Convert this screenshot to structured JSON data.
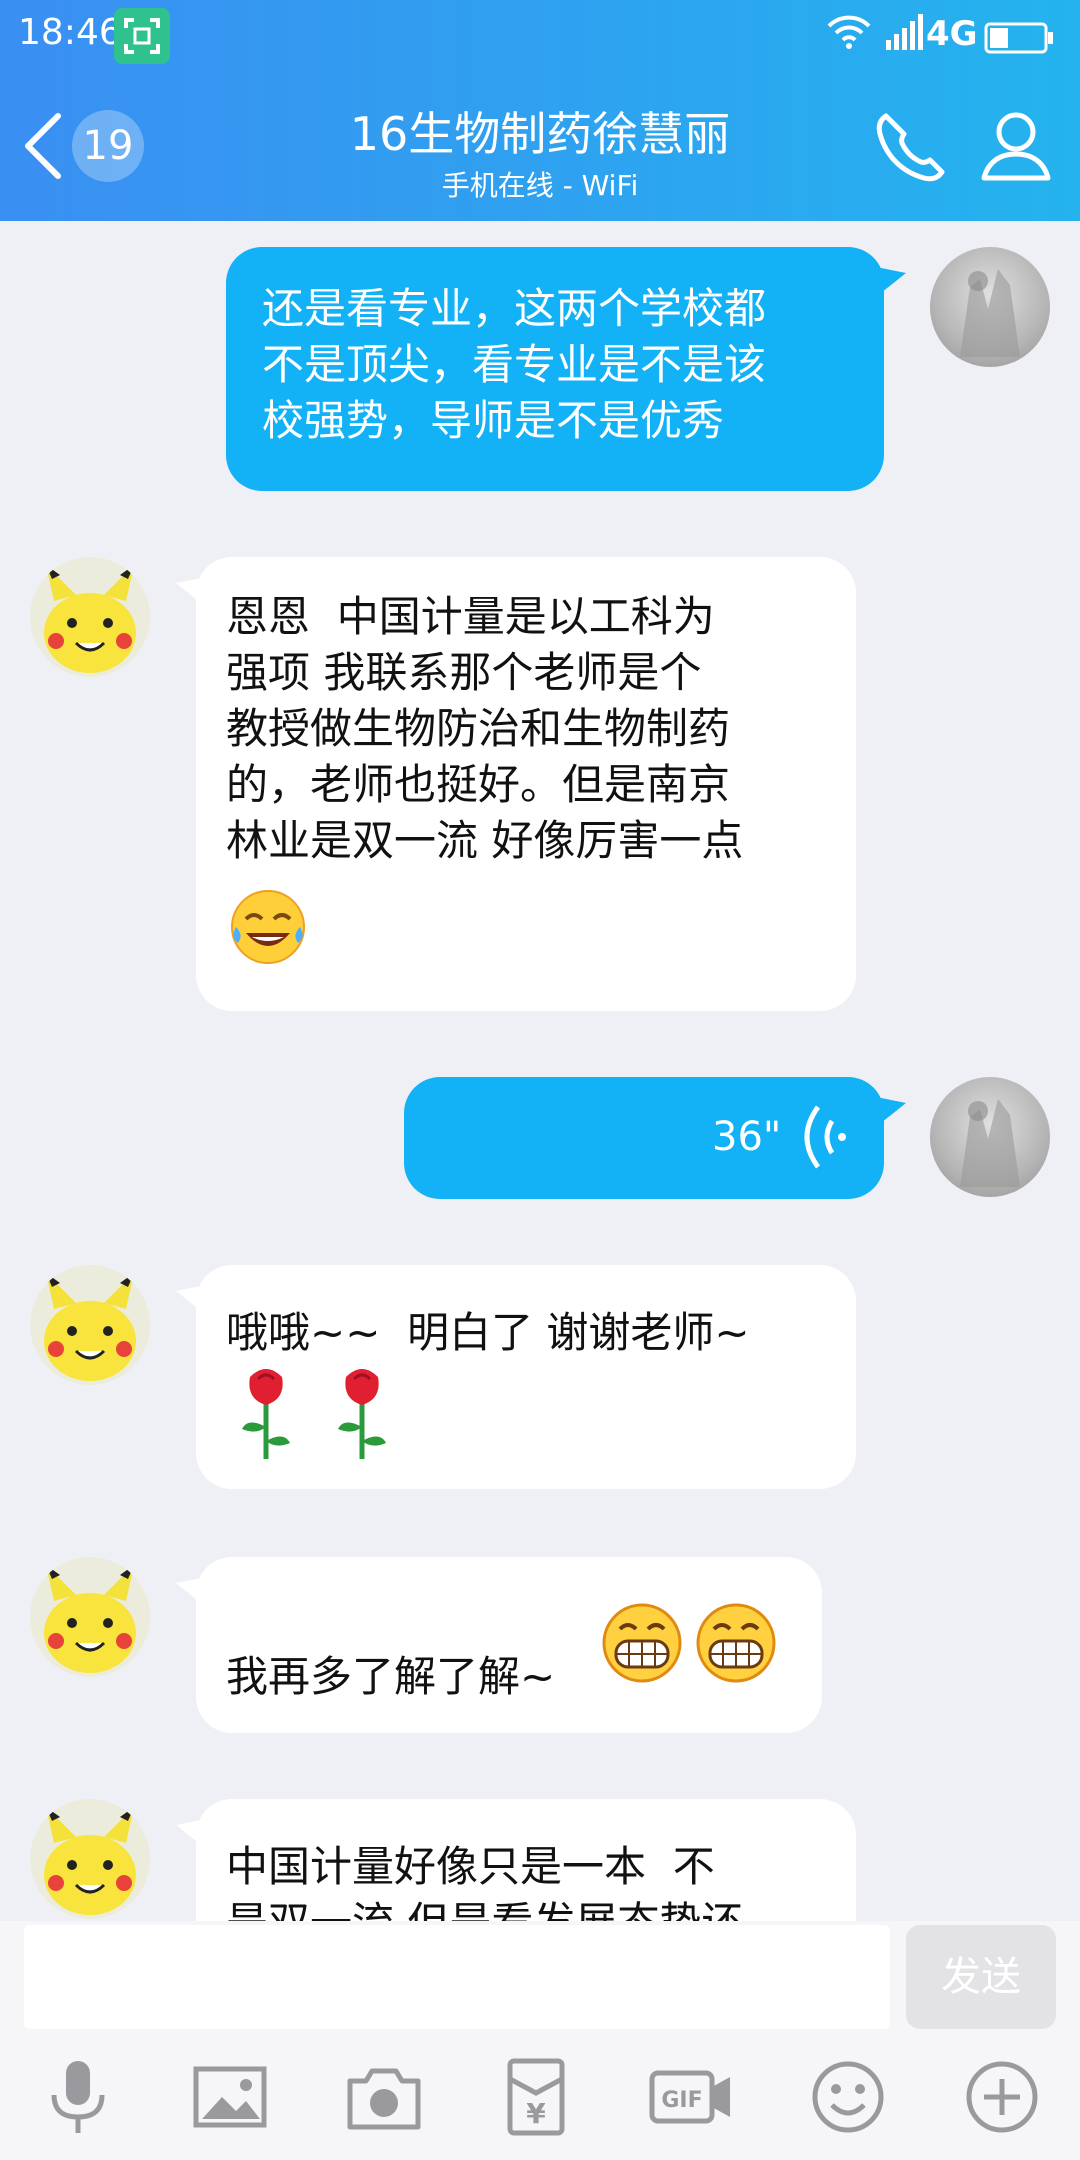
{
  "status": {
    "time": "18:46",
    "network": "4G"
  },
  "header": {
    "unread_count": "19",
    "title": "16生物制药徐慧丽",
    "subtitle": "手机在线 - WiFi"
  },
  "messages": [
    {
      "sender": "me",
      "type": "text",
      "text": "还是看专业，这两个学校都\n不是顶尖，看专业是不是该\n校强势，导师是不是优秀"
    },
    {
      "sender": "contact",
      "type": "text",
      "text": "恩恩  中国计量是以工科为\n强项 我联系那个老师是个\n教授做生物防治和生物制药\n的，老师也挺好。但是南京\n林业是双一流 好像厉害一点",
      "emoji": [
        "laugh-cry-emoji"
      ]
    },
    {
      "sender": "me",
      "type": "voice",
      "duration": "36\""
    },
    {
      "sender": "contact",
      "type": "text",
      "text": "哦哦~~  明白了 谢谢老师~",
      "emoji": [
        "rose-emoji",
        "rose-emoji"
      ]
    },
    {
      "sender": "contact",
      "type": "text",
      "text": "我再多了解了解~",
      "emoji": [
        "grin-emoji",
        "grin-emoji"
      ]
    },
    {
      "sender": "contact",
      "type": "text",
      "text": "中国计量好像只是一本  不\n是双一流 但是看发展态势还"
    }
  ],
  "input": {
    "placeholder": "",
    "send_label": "发送"
  },
  "toolbar": [
    "mic-icon",
    "image-icon",
    "camera-icon",
    "red-packet-icon",
    "gif-icon",
    "emoji-icon",
    "plus-icon"
  ],
  "colors": {
    "header_start": "#3a8ff2",
    "header_end": "#24b3ee",
    "bubble_out": "#13b1f5",
    "bubble_in": "#ffffff",
    "chat_bg": "#eff0f5"
  }
}
